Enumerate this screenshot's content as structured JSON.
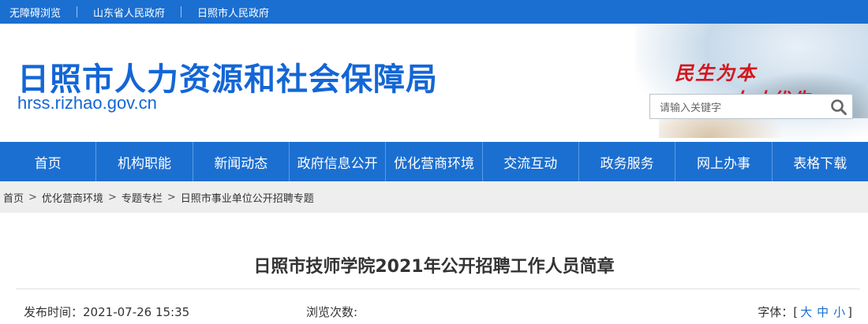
{
  "topbar": {
    "links": [
      "无障碍浏览",
      "山东省人民政府",
      "日照市人民政府"
    ]
  },
  "header": {
    "title": "日照市人力资源和社会保障局",
    "domain": "hrss.rizhao.gov.cn",
    "slogan_line1": "民生为本",
    "slogan_line2": "人才优先"
  },
  "search": {
    "placeholder": "请输入关键字",
    "icon": "search-icon"
  },
  "nav": {
    "items": [
      "首页",
      "机构职能",
      "新闻动态",
      "政府信息公开",
      "优化营商环境",
      "交流互动",
      "政务服务",
      "网上办事",
      "表格下载"
    ]
  },
  "breadcrumb": {
    "items": [
      "首页",
      "优化营商环境",
      "专题专栏",
      "日照市事业单位公开招聘专题"
    ],
    "separator": ">"
  },
  "article": {
    "title": "日照市技师学院2021年公开招聘工作人员简章",
    "publish_label": "发布时间：",
    "publish_time": "2021-07-26 15:35",
    "views_label": "浏览次数:",
    "font_label": "字体：[",
    "font_large": "大",
    "font_medium": "中",
    "font_small": "小",
    "font_close": "]"
  },
  "colors": {
    "primary_blue": "#1b6fd0",
    "title_blue": "#1366d6",
    "slogan_red": "#d4161d",
    "breadcrumb_bg": "#eeeeee"
  }
}
